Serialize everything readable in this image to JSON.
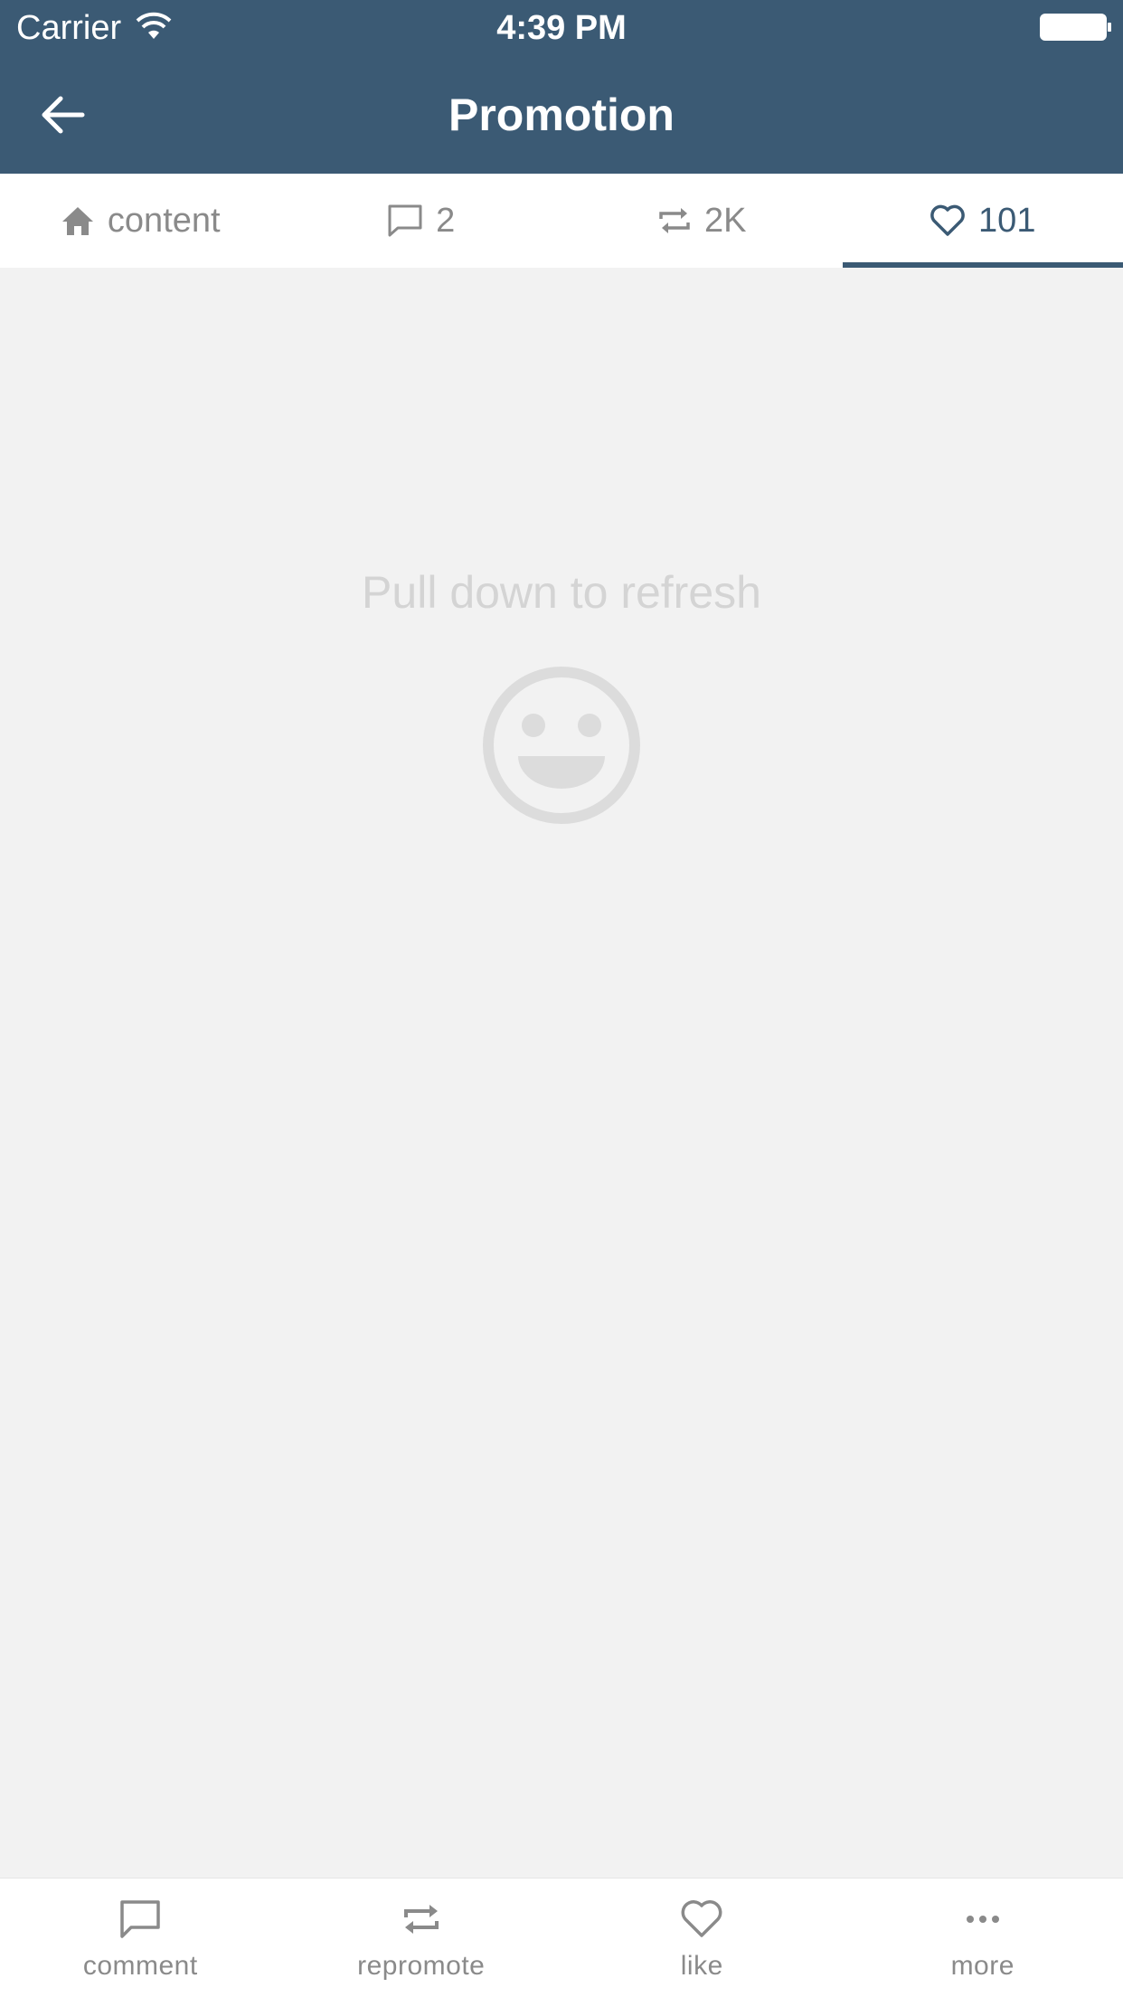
{
  "status_bar": {
    "carrier": "Carrier",
    "time": "4:39 PM"
  },
  "header": {
    "title": "Promotion",
    "back_icon": "arrow-left-icon"
  },
  "tabs": [
    {
      "icon": "home-icon",
      "label": "content",
      "active": false
    },
    {
      "icon": "comment-icon",
      "label": "2",
      "active": false
    },
    {
      "icon": "repost-icon",
      "label": "2K",
      "active": false
    },
    {
      "icon": "heart-icon",
      "label": "101",
      "active": true
    }
  ],
  "empty_state": {
    "message": "Pull down to refresh",
    "icon": "smiley-icon"
  },
  "toolbar": [
    {
      "icon": "comment-icon",
      "label": "comment"
    },
    {
      "icon": "repost-icon",
      "label": "repromote"
    },
    {
      "icon": "heart-icon",
      "label": "like"
    },
    {
      "icon": "more-icon",
      "label": "more"
    }
  ],
  "colors": {
    "brand": "#3b5a74",
    "background": "#f2f2f2",
    "inactive": "#8a8a8a",
    "empty_state": "#d4d4d4"
  }
}
